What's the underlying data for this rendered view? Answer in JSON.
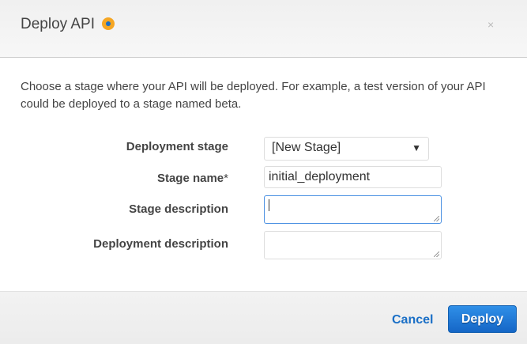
{
  "dialog": {
    "title": "Deploy API",
    "close": "×"
  },
  "intro": "Choose a stage where your API will be deployed. For example, a test version of your API could be deployed to a stage named beta.",
  "form": {
    "deployment_stage": {
      "label": "Deployment stage",
      "value": "[New Stage]",
      "arrow": "▼"
    },
    "stage_name": {
      "label": "Stage name",
      "required": "*",
      "value": "initial_deployment"
    },
    "stage_description": {
      "label": "Stage description",
      "value": ""
    },
    "deployment_description": {
      "label": "Deployment description",
      "value": ""
    }
  },
  "footer": {
    "cancel": "Cancel",
    "deploy": "Deploy"
  }
}
